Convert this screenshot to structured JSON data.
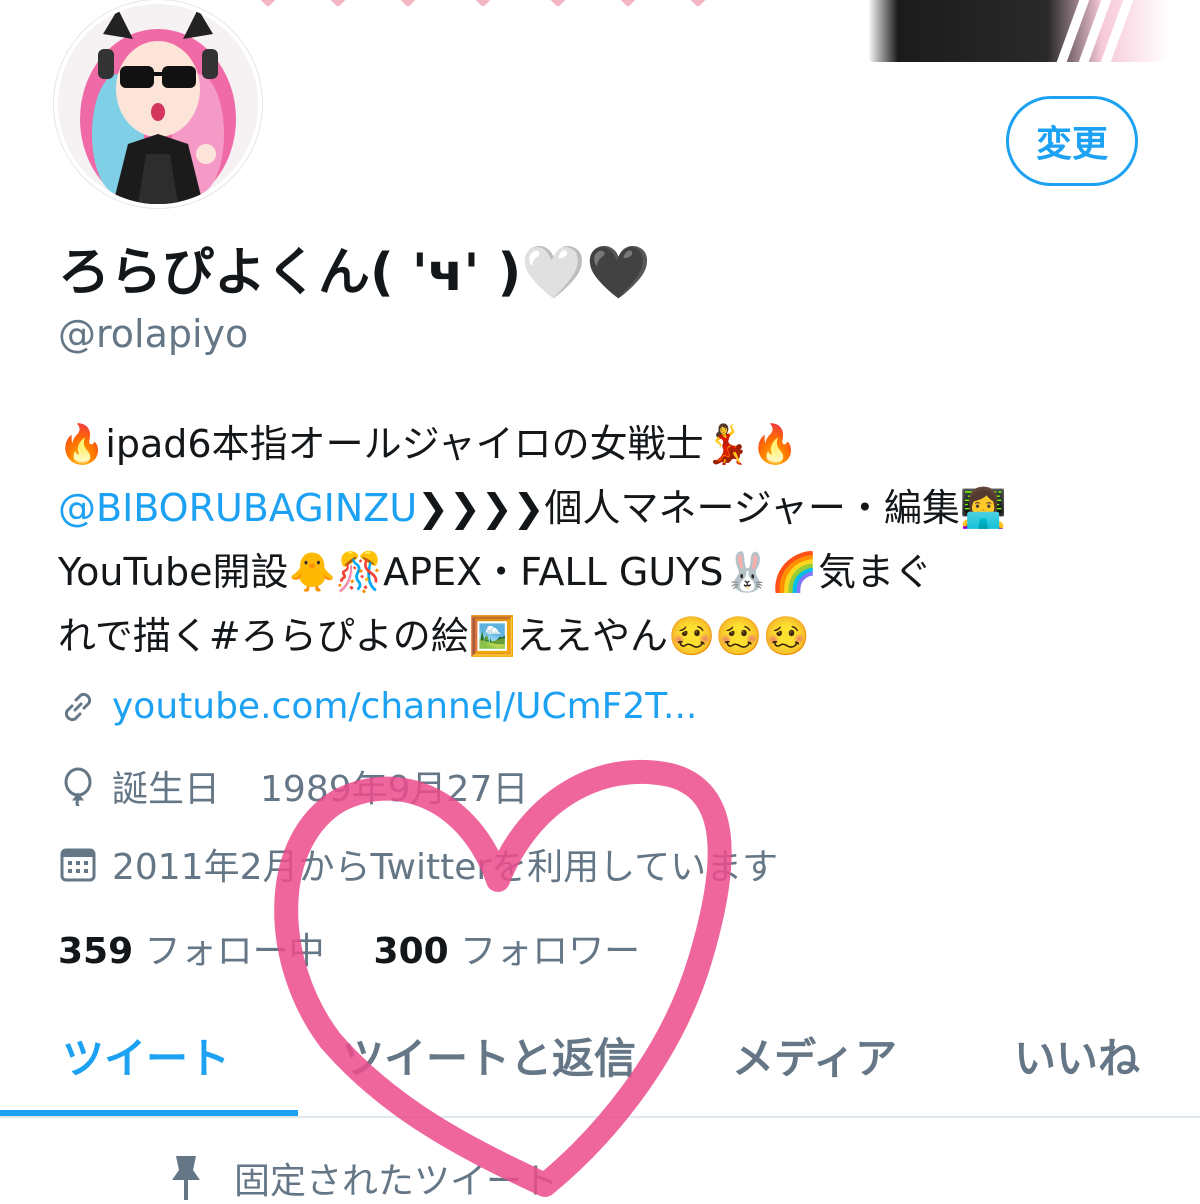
{
  "profile": {
    "display_name": "ろらぴよくん( 'ч' )🤍🖤",
    "handle": "@rolapiyo",
    "edit_button": "変更"
  },
  "bio": {
    "line1": "🔥ipad6本指オールジャイロの女戦士💃🔥",
    "line2_mention": "@BIBORUBAGINZU",
    "line2_rest": "❯❯❯❯個人マネージャー・編集👩‍💻",
    "line3": "YouTube開設🐥🎊APEX・FALL GUYS🐰🌈気まぐ",
    "line4": "れで描く#ろらぴよの絵🖼️ええやん🥴🥴🥴"
  },
  "meta": {
    "link": "youtube.com/channel/UCmF2T...",
    "birthday_label": "誕生日",
    "birthday": "1989年9月27日",
    "joined": "2011年2月からTwitterを利用しています"
  },
  "stats": {
    "following_count": "359",
    "following_label": "フォロー中",
    "followers_count": "300",
    "followers_label": "フォロワー"
  },
  "tabs": [
    {
      "label": "ツイート",
      "active": true
    },
    {
      "label": "ツイートと返信",
      "active": false
    },
    {
      "label": "メディア",
      "active": false
    },
    {
      "label": "いいね",
      "active": false
    }
  ],
  "pinned": {
    "label": "固定されたツイート"
  },
  "colors": {
    "accent": "#1da1f2",
    "secondary_text": "#657786",
    "overlay_heart": "#ec4b8c"
  }
}
